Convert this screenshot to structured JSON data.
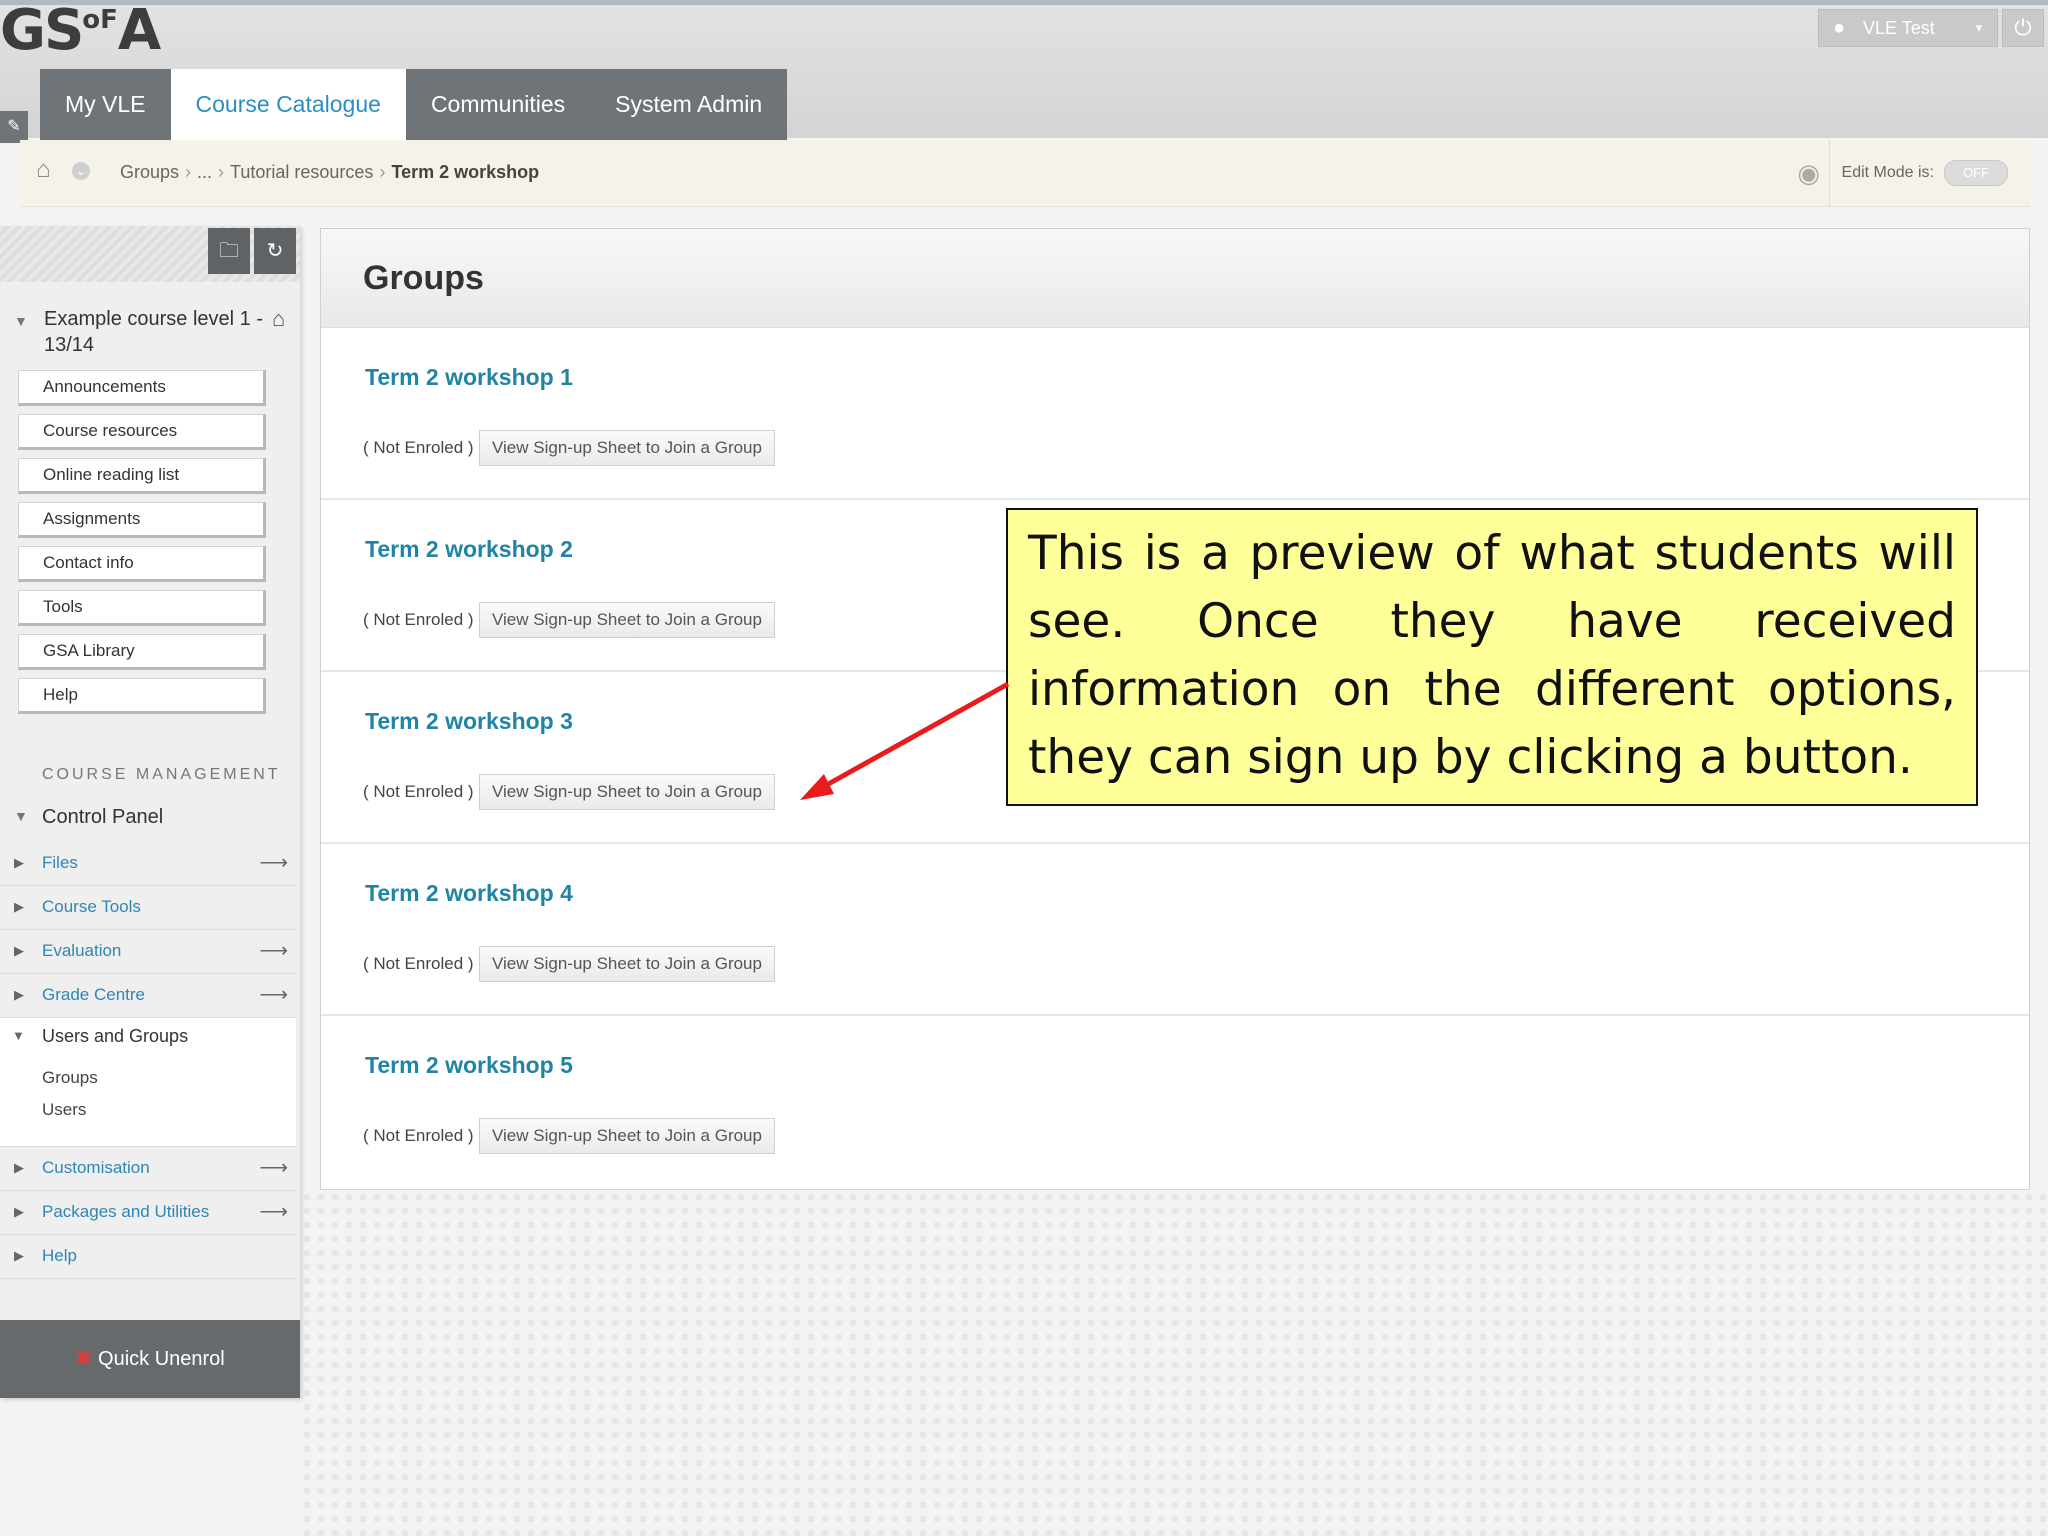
{
  "header": {
    "logo_main": "GS",
    "logo_small": "oF",
    "logo_end": "A",
    "user_name": "VLE Test",
    "tabs": [
      {
        "label": "My VLE"
      },
      {
        "label": "Course Catalogue"
      },
      {
        "label": "Communities"
      },
      {
        "label": "System Admin"
      }
    ]
  },
  "breadcrumb": {
    "items": [
      "Groups",
      "...",
      "Tutorial resources"
    ],
    "current": "Term 2 workshop",
    "edit_mode_label": "Edit Mode is:",
    "edit_mode_value": "OFF"
  },
  "sidebar": {
    "course_title": "Example course level 1 - 13/14",
    "menu": [
      "Announcements",
      "Course resources",
      "Online reading list",
      "Assignments",
      "Contact info",
      "Tools",
      "GSA Library",
      "Help"
    ],
    "course_management_heading": "COURSE MANAGEMENT",
    "control_panel": "Control Panel",
    "cp_items_top": [
      "Files",
      "Course Tools",
      "Evaluation",
      "Grade Centre"
    ],
    "users_groups": {
      "label": "Users and Groups",
      "sub": [
        "Groups",
        "Users"
      ]
    },
    "cp_items_bottom": [
      "Customisation",
      "Packages and Utilities",
      "Help"
    ],
    "quick_unenrol": "Quick Unenrol"
  },
  "main": {
    "title": "Groups",
    "groups": [
      {
        "title": "Term 2 workshop 1",
        "status": "( Not Enroled )",
        "button": "View Sign-up Sheet to Join a Group"
      },
      {
        "title": "Term 2 workshop 2",
        "status": "( Not Enroled )",
        "button": "View Sign-up Sheet to Join a Group"
      },
      {
        "title": "Term 2 workshop 3",
        "status": "( Not Enroled )",
        "button": "View Sign-up Sheet to Join a Group"
      },
      {
        "title": "Term 2 workshop 4",
        "status": "( Not Enroled )",
        "button": "View Sign-up Sheet to Join a Group"
      },
      {
        "title": "Term 2 workshop 5",
        "status": "( Not Enroled )",
        "button": "View Sign-up Sheet to Join a Group"
      }
    ]
  },
  "callout": {
    "text": "This is a preview of what students will see. Once they have received information on the different options, they can sign up by clicking a button."
  },
  "colors": {
    "link_blue": "#1f84a6",
    "active_tab_text": "#2a8fc0",
    "tab_bg": "#6f7478",
    "callout_bg": "#ffff99",
    "arrow_red": "#e81c1c"
  },
  "icons": [
    "user-icon",
    "power-icon",
    "home-icon",
    "eye-icon",
    "folder-icon",
    "refresh-icon",
    "lock-icon",
    "arrow-right-icon",
    "close-icon"
  ]
}
